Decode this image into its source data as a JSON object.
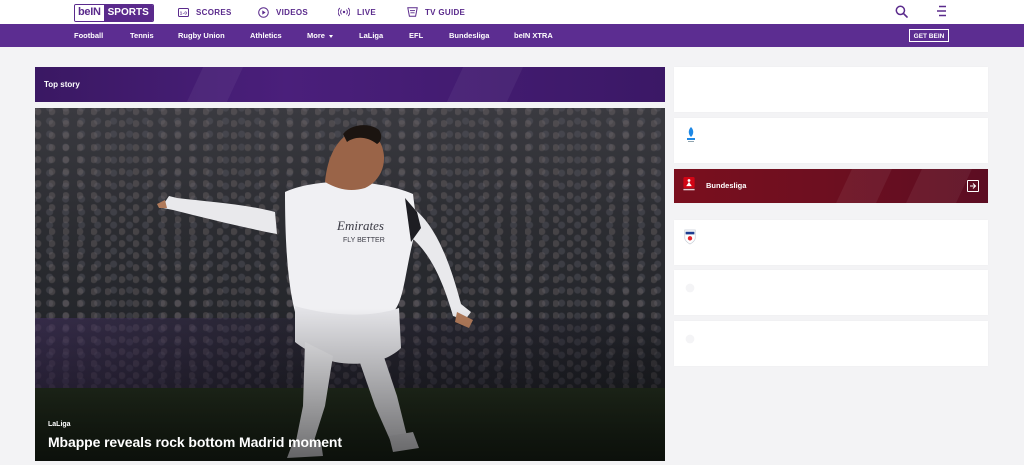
{
  "header": {
    "logo_part1": "beIN",
    "logo_part2": "SPORTS",
    "nav": [
      {
        "label": "SCORES",
        "icon": "scores-icon"
      },
      {
        "label": "VIDEOS",
        "icon": "play-icon"
      },
      {
        "label": "LIVE",
        "icon": "live-icon"
      },
      {
        "label": "TV GUIDE",
        "icon": "tv-guide-icon"
      }
    ]
  },
  "categories": [
    "Football",
    "Tennis",
    "Rugby Union",
    "Athletics",
    "More",
    "LaLiga",
    "EFL",
    "Bundesliga",
    "beIN XTRA"
  ],
  "cta": {
    "get_bein": "GET BEIN"
  },
  "top_story": {
    "label": "Top story",
    "category": "LaLiga",
    "title": "Mbappe reveals rock bottom Madrid moment",
    "jersey_sponsor": "Emirates",
    "jersey_tagline": "FLY BETTER"
  },
  "leagues": {
    "active_label": "Bundesliga",
    "icons": [
      "serie-a-logo",
      "bundesliga-logo",
      "efl-logo",
      "league-logo",
      "league-logo"
    ]
  },
  "colors": {
    "brand_purple": "#5c2d91",
    "bundesliga_red": "#7a0f1e"
  }
}
